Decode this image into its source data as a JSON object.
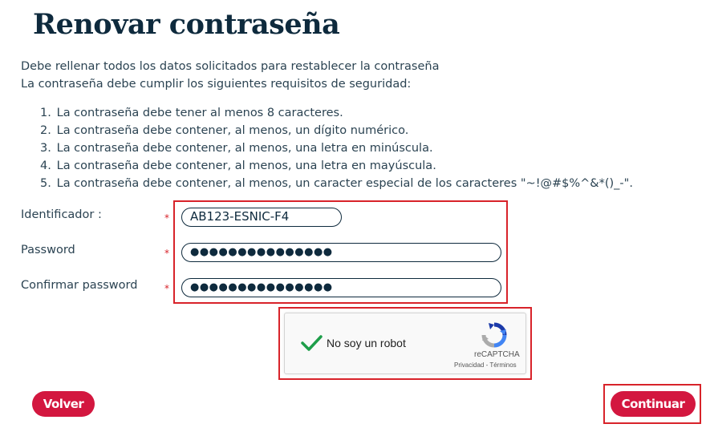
{
  "page": {
    "title": "Renovar contraseña",
    "intro_line1": "Debe rellenar todos los datos solicitados para restablecer la contraseña",
    "intro_line2": "La contraseña debe cumplir los siguientes requisitos de seguridad:"
  },
  "requirements": [
    {
      "num": "1.",
      "text": "La contraseña debe tener al menos 8 caracteres."
    },
    {
      "num": "2.",
      "text": "La contraseña debe contener, al menos, un dígito numérico."
    },
    {
      "num": "3.",
      "text": "La contraseña debe contener, al menos, una letra en minúscula."
    },
    {
      "num": "4.",
      "text": "La contraseña debe contener, al menos, una letra en mayúscula."
    },
    {
      "num": "5.",
      "text": "La contraseña debe contener, al menos, un caracter especial de los caracteres \"~!@#$%^&*()_-\"."
    }
  ],
  "form": {
    "required_mark": "*",
    "identificador": {
      "label": "Identificador :",
      "value": "AB123-ESNIC-F4"
    },
    "password": {
      "label": "Password",
      "value": "●●●●●●●●●●●●●●●"
    },
    "confirm_password": {
      "label": "Confirmar password",
      "value": "●●●●●●●●●●●●●●●"
    }
  },
  "captcha": {
    "label": "No soy un robot",
    "brand": "reCAPTCHA",
    "privacy": "Privacidad",
    "separator": "-",
    "terms": "Términos",
    "checked": true,
    "check_color": "#1e9e4a"
  },
  "buttons": {
    "back": "Volver",
    "continue": "Continuar"
  },
  "colors": {
    "accent": "#d3173f",
    "highlight": "#d8232a",
    "title": "#0e2a3d"
  }
}
